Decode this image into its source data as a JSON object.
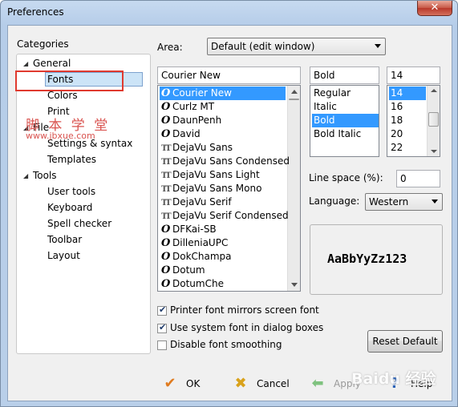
{
  "window": {
    "title": "Preferences",
    "close_glyph": "✕"
  },
  "categories": {
    "heading": "Categories",
    "tree": [
      {
        "label": "General",
        "expanded": true
      },
      {
        "label": "Fonts",
        "selected": true
      },
      {
        "label": "Colors"
      },
      {
        "label": "Print"
      },
      {
        "label": "File",
        "expanded": true
      },
      {
        "label": "Settings & syntax"
      },
      {
        "label": "Templates"
      },
      {
        "label": "Tools",
        "expanded": true
      },
      {
        "label": "User tools"
      },
      {
        "label": "Keyboard"
      },
      {
        "label": "Spell checker"
      },
      {
        "label": "Toolbar"
      },
      {
        "label": "Layout"
      }
    ]
  },
  "area": {
    "label": "Area:",
    "value": "Default (edit window)"
  },
  "font": {
    "value": "Courier New",
    "list": [
      {
        "name": "Courier New",
        "icon": "O",
        "selected": true
      },
      {
        "name": "Curlz MT",
        "icon": "O"
      },
      {
        "name": "DaunPenh",
        "icon": "O"
      },
      {
        "name": "David",
        "icon": "O"
      },
      {
        "name": "DejaVu Sans",
        "icon": "TT"
      },
      {
        "name": "DejaVu Sans Condensed",
        "icon": "TT"
      },
      {
        "name": "DejaVu Sans Light",
        "icon": "TT"
      },
      {
        "name": "DejaVu Sans Mono",
        "icon": "TT"
      },
      {
        "name": "DejaVu Serif",
        "icon": "TT"
      },
      {
        "name": "DejaVu Serif Condensed",
        "icon": "TT"
      },
      {
        "name": "DFKai-SB",
        "icon": "O"
      },
      {
        "name": "DilleniaUPC",
        "icon": "O"
      },
      {
        "name": "DokChampa",
        "icon": "O"
      },
      {
        "name": "Dotum",
        "icon": "O"
      },
      {
        "name": "DotumChe",
        "icon": "O"
      }
    ]
  },
  "style": {
    "value": "Bold",
    "list": [
      {
        "name": "Regular"
      },
      {
        "name": "Italic"
      },
      {
        "name": "Bold",
        "selected": true
      },
      {
        "name": "Bold Italic"
      }
    ]
  },
  "size": {
    "value": "14",
    "list": [
      {
        "name": "14",
        "selected": true
      },
      {
        "name": "16"
      },
      {
        "name": "18"
      },
      {
        "name": "20"
      },
      {
        "name": "22"
      }
    ]
  },
  "line_space": {
    "label": "Line space (%):",
    "value": "0"
  },
  "language": {
    "label": "Language:",
    "value": "Western"
  },
  "preview": {
    "text": "AaBbYyZz123"
  },
  "options": [
    {
      "label": "Printer font mirrors screen font",
      "checked": true
    },
    {
      "label": "Use system font in dialog boxes",
      "checked": true
    },
    {
      "label": "Disable font smoothing",
      "checked": false
    }
  ],
  "reset_button": "Reset Default",
  "footer": {
    "ok": "OK",
    "cancel": "Cancel",
    "apply": "Apply",
    "help": "Help"
  },
  "watermarks": {
    "site_cn": "脚 本 学 堂",
    "site_url": "www.jbxue.com",
    "baidu": "Baidu 经验"
  },
  "colors": {
    "selection": "#3399ff",
    "highlight_box": "#e03a2f",
    "watermark": "#d9534f",
    "ok_check": "#e07b1f",
    "cancel_x": "#d9a21b",
    "apply_arrow": "#7fc27f",
    "help_icon": "#2a62b8"
  }
}
